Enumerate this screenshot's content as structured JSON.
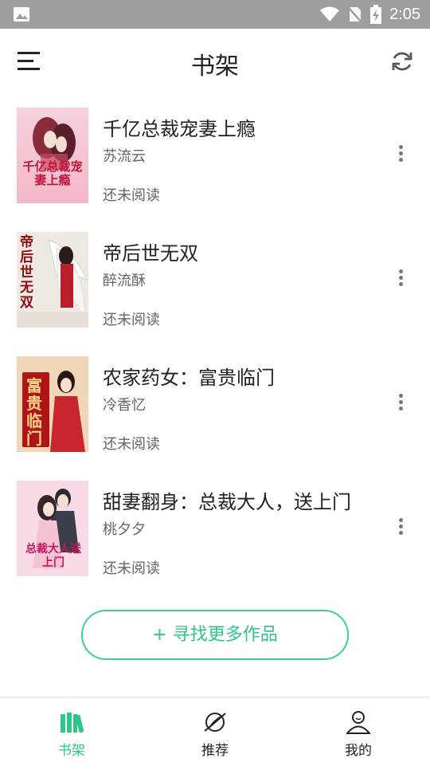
{
  "status_bar": {
    "time": "2:05",
    "icons": [
      "image-notification-icon",
      "wifi-icon",
      "no-sim-icon",
      "battery-charging-icon"
    ]
  },
  "app_bar": {
    "title": "书架",
    "left_icon": "menu-icon",
    "right_icon": "refresh-icon"
  },
  "books": [
    {
      "title": "千亿总裁宠妻上瘾",
      "author": "苏流云",
      "status": "还未阅读",
      "cover_text": "千亿总裁宠妻上瘾"
    },
    {
      "title": "帝后世无双",
      "author": "醉流酥",
      "status": "还未阅读",
      "cover_text": "帝后世无双"
    },
    {
      "title": "农家药女：富贵临门",
      "author": "冷香忆",
      "status": "还未阅读",
      "cover_text": "富贵临门"
    },
    {
      "title": "甜妻翻身：总裁大人，送上门",
      "author": "桃夕夕",
      "status": "还未阅读",
      "cover_text": "总裁大人送上门"
    }
  ],
  "find_more_label": "+ 寻找更多作品",
  "tabs": [
    {
      "label": "书架",
      "icon": "bookshelf-icon",
      "active": true
    },
    {
      "label": "推荐",
      "icon": "planet-icon",
      "active": false
    },
    {
      "label": "我的",
      "icon": "user-icon",
      "active": false
    }
  ],
  "colors": {
    "accent": "#2fc58c",
    "status_bar": "#9e9e9e"
  }
}
